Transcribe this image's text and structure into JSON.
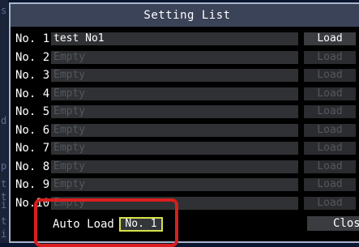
{
  "background": {
    "side_letters": [
      "s",
      "d",
      "p",
      "t",
      "t",
      "i",
      "t",
      "i"
    ]
  },
  "dialog": {
    "title": "Setting List",
    "rows": [
      {
        "label": "No. 1",
        "name": "test No1",
        "load": "Load",
        "enabled": true
      },
      {
        "label": "No. 2",
        "name": "Empty",
        "load": "Load",
        "enabled": false
      },
      {
        "label": "No. 3",
        "name": "Empty",
        "load": "Load",
        "enabled": false
      },
      {
        "label": "No. 4",
        "name": "Empty",
        "load": "Load",
        "enabled": false
      },
      {
        "label": "No. 5",
        "name": "Empty",
        "load": "Load",
        "enabled": false
      },
      {
        "label": "No. 6",
        "name": "Empty",
        "load": "Load",
        "enabled": false
      },
      {
        "label": "No. 7",
        "name": "Empty",
        "load": "Load",
        "enabled": false
      },
      {
        "label": "No. 8",
        "name": "Empty",
        "load": "Load",
        "enabled": false
      },
      {
        "label": "No. 9",
        "name": "Empty",
        "load": "Load",
        "enabled": false
      },
      {
        "label": "No.10",
        "name": "Empty",
        "load": "Load",
        "enabled": false
      }
    ],
    "auto_load": {
      "label": "Auto Load",
      "value": "No. 1"
    },
    "close_label": "Close"
  },
  "colors": {
    "dialog_border": "#a9b7cc",
    "title_bar": "#3a4357",
    "selection_border": "#d8e04a",
    "highlight": "#d81e1e"
  }
}
